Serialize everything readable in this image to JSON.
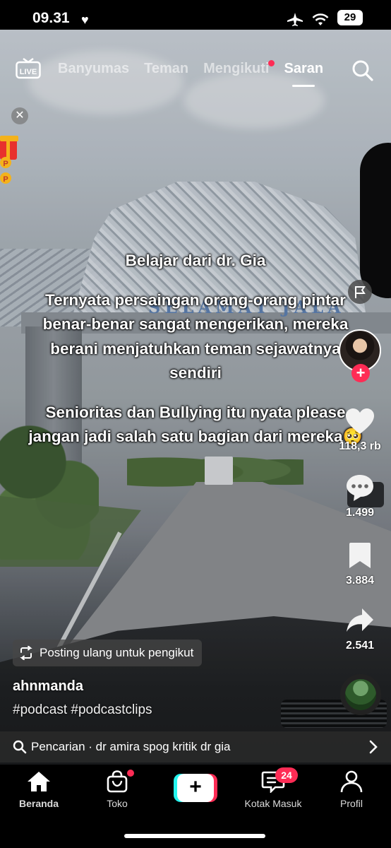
{
  "status_bar": {
    "time": "09.31",
    "battery": "29"
  },
  "top_nav": {
    "live_label": "LIVE",
    "tabs": [
      {
        "label": "Banyumas",
        "active": false
      },
      {
        "label": "Teman",
        "active": false
      },
      {
        "label": "Mengikuti",
        "active": false,
        "has_dot": true
      },
      {
        "label": "Saran",
        "active": true
      }
    ]
  },
  "caption": {
    "lines": [
      "Belajar dari dr. Gia",
      "Ternyata persaingan orang-orang pintar benar-benar sangat mengerikan, mereka berani menjatuhkan teman sejawatnya sendiri",
      "Senioritas dan Bullying itu nyata please jangan jadi salah satu bagian dari mereka🥺"
    ]
  },
  "gate_sign": "SELAMAT JALA",
  "actions": {
    "likes": "118,3 rb",
    "comments": "1.499",
    "saves": "3.884",
    "shares": "2.541"
  },
  "post": {
    "repost_label": "Posting ulang untuk pengikut",
    "username": "ahnmanda",
    "hashtags": "#podcast #podcastclips"
  },
  "search_suggestion": {
    "prefix": "Pencarian · ",
    "query": "dr amira spog kritik dr gia"
  },
  "bottom_nav": {
    "home": "Beranda",
    "shop": "Toko",
    "inbox": "Kotak Masuk",
    "inbox_badge": "24",
    "profile": "Profil"
  },
  "colors": {
    "accent_red": "#fe2c55",
    "accent_cyan": "#25f4ee"
  }
}
